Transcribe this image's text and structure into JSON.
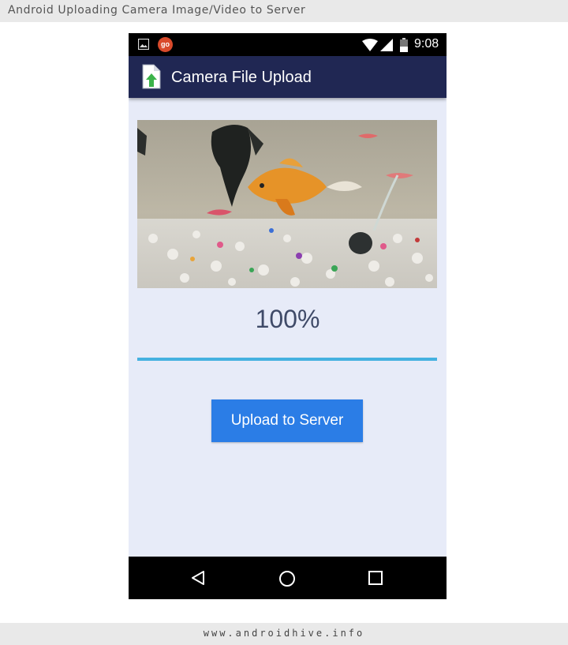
{
  "banner": {
    "title": "Android Uploading Camera Image/Video to Server"
  },
  "footer": {
    "site": "www.androidhive.info"
  },
  "status_bar": {
    "time": "9:08",
    "notification_badge": "go",
    "icons": [
      "image-icon",
      "go-app-icon",
      "wifi-icon",
      "signal-icon",
      "battery-icon"
    ]
  },
  "app_bar": {
    "title": "Camera File Upload",
    "icon": "file-upload-icon"
  },
  "preview": {
    "description_icon": "photo-preview"
  },
  "progress": {
    "text": "100%",
    "value": 1.0
  },
  "upload_button": {
    "label": "Upload to Server"
  },
  "nav_bar": {
    "icons": [
      "back-icon",
      "home-icon",
      "recents-icon"
    ]
  },
  "colors": {
    "app_bar": "#202753",
    "background": "#e7ebf8",
    "button": "#2b7de6",
    "progress": "#45b1e0"
  }
}
